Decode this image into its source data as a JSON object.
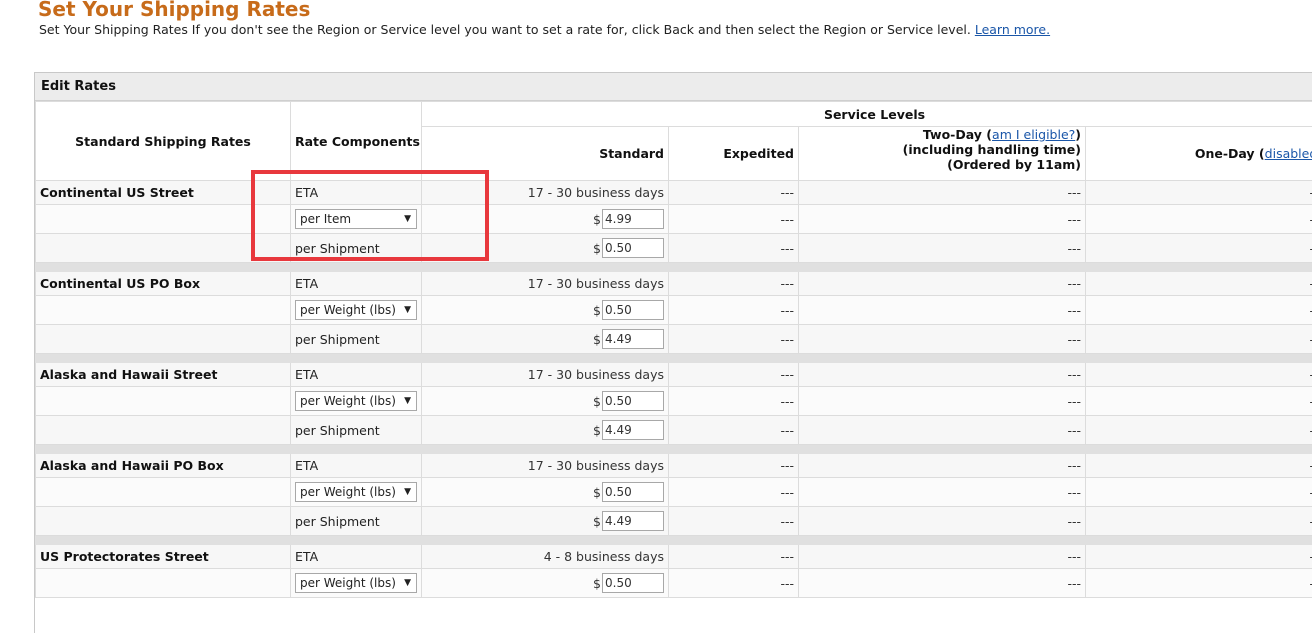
{
  "page": {
    "title": "Set Your Shipping Rates",
    "description": "Set Your Shipping Rates If you don't see the Region or Service level you want to set a rate for, click Back and then select the Region or Service level.",
    "learn_more": "Learn more."
  },
  "panel": {
    "title": "Edit Rates"
  },
  "headers": {
    "standard_rates": "Standard Shipping Rates",
    "rate_components": "Rate Components",
    "service_levels": "Service Levels",
    "standard": "Standard",
    "expedited": "Expedited",
    "two_day": "Two-Day",
    "two_day_link": "am I eligible?",
    "two_day_note1": "(including handling time)",
    "two_day_note2": "(Ordered by 11am)",
    "one_day": "One-Day",
    "one_day_link": "disabled"
  },
  "regions": [
    {
      "name": "Continental US Street",
      "eta_label": "ETA",
      "eta": "17 - 30 business days",
      "item_unit": "per Item",
      "item_value": "4.99",
      "shipment_label": "per Shipment",
      "shipment_value": "0.50"
    },
    {
      "name": "Continental US PO Box",
      "eta_label": "ETA",
      "eta": "17 - 30 business days",
      "item_unit": "per Weight (lbs)",
      "item_value": "0.50",
      "shipment_label": "per Shipment",
      "shipment_value": "4.49"
    },
    {
      "name": "Alaska and Hawaii Street",
      "eta_label": "ETA",
      "eta": "17 - 30 business days",
      "item_unit": "per Weight (lbs)",
      "item_value": "0.50",
      "shipment_label": "per Shipment",
      "shipment_value": "4.49"
    },
    {
      "name": "Alaska and Hawaii PO Box",
      "eta_label": "ETA",
      "eta": "17 - 30 business days",
      "item_unit": "per Weight (lbs)",
      "item_value": "0.50",
      "shipment_label": "per Shipment",
      "shipment_value": "4.49"
    },
    {
      "name": "US Protectorates Street",
      "eta_label": "ETA",
      "eta": "4 - 8 business days",
      "item_unit": "per Weight (lbs)",
      "item_value": "0.50"
    }
  ],
  "symbols": {
    "currency": "$",
    "dash": "---",
    "dropdown_arrow": "▼"
  },
  "colors": {
    "title": "#c76b1a",
    "link": "#1a56a8",
    "highlight_box": "#e8383d"
  }
}
